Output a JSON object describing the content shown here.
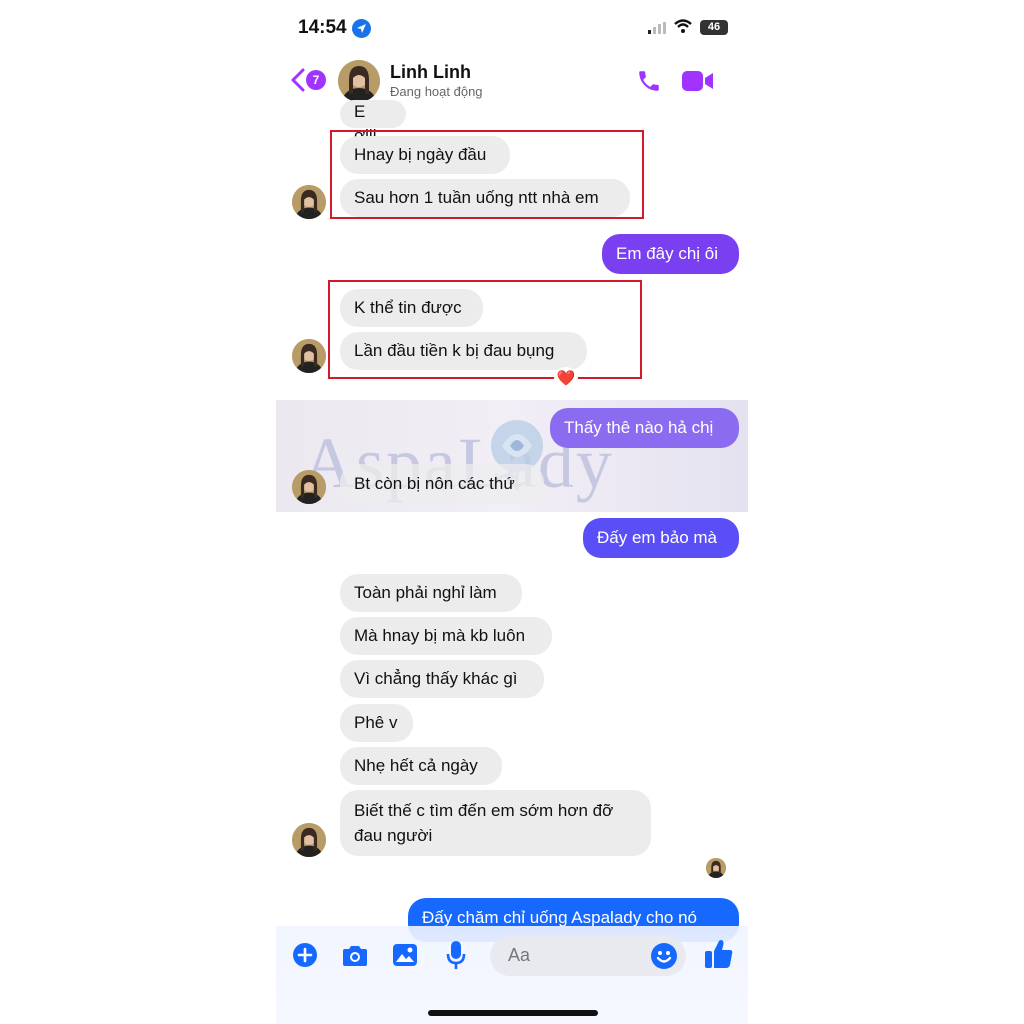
{
  "status_bar": {
    "time": "14:54",
    "battery": "46"
  },
  "header": {
    "unread_count": "7",
    "contact_name": "Linh Linh",
    "contact_status": "Đang hoạt động"
  },
  "messages": {
    "m1": "E ơiii",
    "m2": "Hnay bị ngày đầu",
    "m3": "Sau hơn 1 tuần uống ntt nhà em",
    "m4": "Em đây chị ôi",
    "m5": "K thể tin được",
    "m6": "Lần đầu tiền k bị đau bụng",
    "m7": "Thấy thê nào hả chị",
    "m8": "Bt còn bị nôn các thứ",
    "m9": "Đấy em bảo mà",
    "m10": "Toàn phải nghỉ làm",
    "m11": "Mà hnay bị mà kb luôn",
    "m12": "Vì chẳng thấy khác gì",
    "m13": "Phê v",
    "m14": "Nhẹ hết cả ngày",
    "m15": "Biết thế c tìm đến em sớm hơn đỡ\nđau người",
    "m16": "Đấy chăm chỉ uống Aspalady cho nó"
  },
  "reaction": "❤️",
  "watermark": {
    "text": "AspaLady"
  },
  "composer": {
    "placeholder": "Aa"
  },
  "colors": {
    "accent": "#a033ff",
    "outgoing": "#7b3ff2",
    "outgoing_blue": "#1668ff",
    "incoming": "#ececec",
    "highlight_box": "#d11a2a"
  }
}
